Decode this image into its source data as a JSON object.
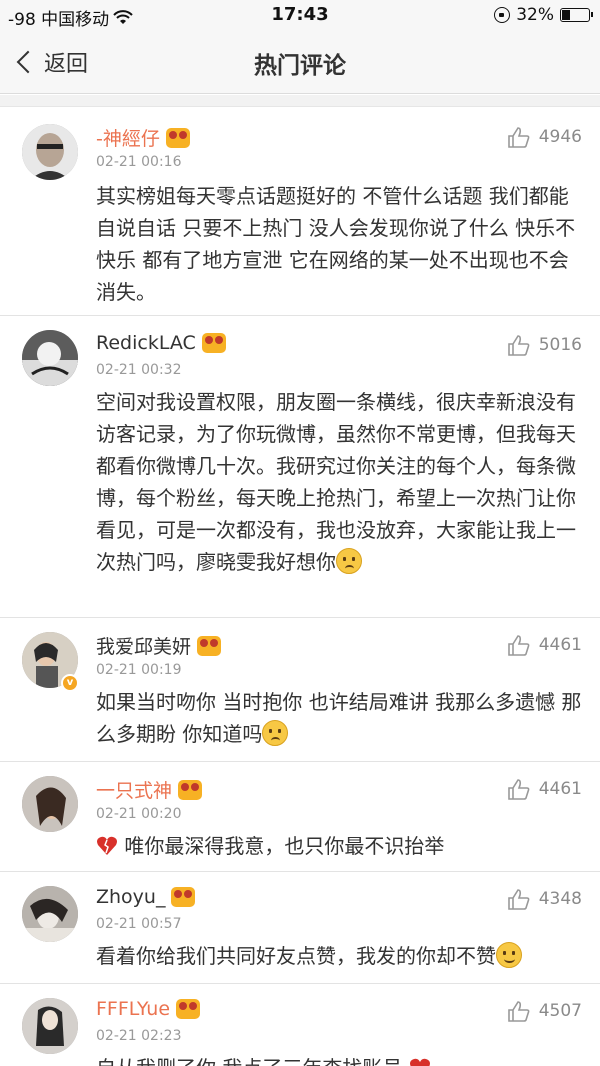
{
  "status_bar": {
    "carrier": "-98 中国移动",
    "time": "17:43",
    "battery": "32%",
    "battery_level": 0.32
  },
  "nav": {
    "back_label": "返回",
    "title": "热门评论"
  },
  "comments": [
    {
      "username": "-神經仔",
      "timestamp": "02-21 00:16",
      "likes": "4946",
      "text": "其实榜姐每天零点话题挺好的 不管什么话题 我们都能自说自话 只要不上热门 没人会发现你说了什么 快乐不快乐 都有了地方宣泄 它在网络的某一处不出现也不会消失。"
    },
    {
      "username": "RedickLAC",
      "timestamp": "02-21 00:32",
      "likes": "5016",
      "text": "空间对我设置权限，朋友圈一条横线，很庆幸新浪没有访客记录，为了你玩微博，虽然你不常更博，但我每天都看你微博几十次。我研究过你关注的每个人，每条微博，每个粉丝，每天晚上抢热门，希望上一次热门让你看见，可是一次都没有，我也没放弃，大家能让我上一次热门吗，廖晓雯我好想你"
    },
    {
      "username": "我爱邱美妍",
      "timestamp": "02-21 00:19",
      "likes": "4461",
      "text": "如果当时吻你 当时抱你 也许结局难讲 我那么多遗憾 那么多期盼 你知道吗"
    },
    {
      "username": "一只式神",
      "timestamp": "02-21 00:20",
      "likes": "4461",
      "text": "唯你最深得我意，也只你最不识抬举"
    },
    {
      "username": "Zhoyu_",
      "timestamp": "02-21 00:57",
      "likes": "4348",
      "text": "看着你给我们共同好友点赞，我发的你却不赞"
    },
    {
      "username": "FFFLYue",
      "timestamp": "02-21 02:23",
      "likes": "4507",
      "text": "自从我删了你 我点了三年查找账号"
    }
  ],
  "colors": {
    "accent_orange": "#eb7350",
    "badge_gold": "#f7b124"
  }
}
